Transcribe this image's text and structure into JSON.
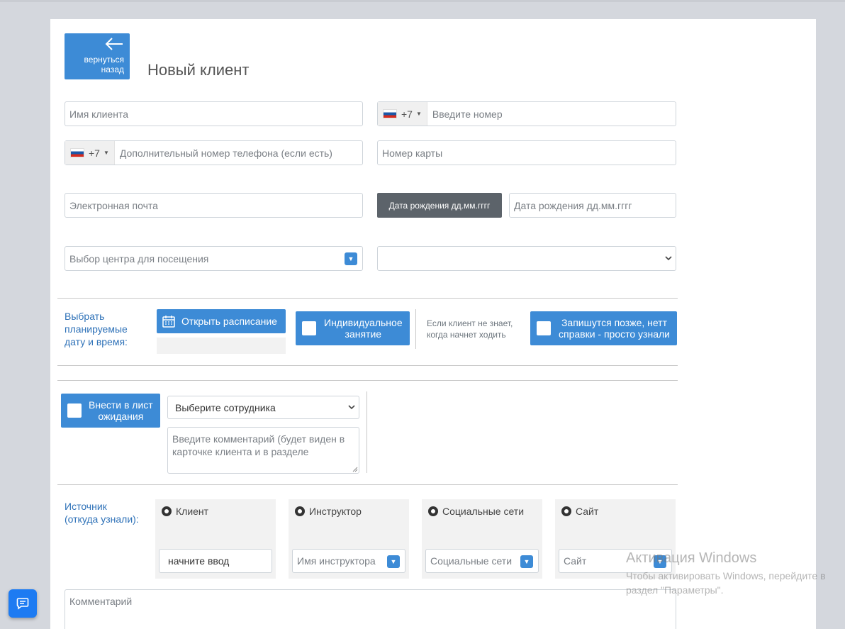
{
  "header": {
    "back_label_1": "вернуться",
    "back_label_2": "назад",
    "title": "Новый клиент"
  },
  "form": {
    "client_name_placeholder": "Имя клиента",
    "phone_code": "+7",
    "phone_placeholder": "Введите номер",
    "extra_phone_code": "+7",
    "extra_phone_placeholder": "Дополнительный номер телефона (если есть)",
    "card_placeholder": "Номер карты",
    "email_placeholder": "Электронная почта",
    "dob_label": "Дата рождения дд.мм.гггг",
    "dob_placeholder": "Дата рождения дд.мм.гггг",
    "center_placeholder": "Выбор центра для посещения",
    "second_select_value": ""
  },
  "schedule": {
    "label_1": "Выбрать",
    "label_2": "планируемые",
    "label_3": "дату и время:",
    "open_schedule": "Открыть расписание",
    "individual_1": "Индивидуальное",
    "individual_2": "занятие",
    "unknown_1": "Если клиент не знает,",
    "unknown_2": "когда начнет ходить",
    "later_1": "Запишутся позже, нетт",
    "later_2": "справки - просто узнали"
  },
  "waitlist": {
    "label_1": "Внести в лист",
    "label_2": "ожидания",
    "employee_select": "Выберите сотрудника",
    "comment_placeholder_1": "Введите комментарий (будет виден в",
    "comment_placeholder_2": "карточке клиента и в разделе"
  },
  "source": {
    "label_1": "Источник",
    "label_2": "(откуда узнали):",
    "options": [
      {
        "label": "Клиент",
        "input": "начните ввод"
      },
      {
        "label": "Инструктор",
        "input": "Имя инструктора"
      },
      {
        "label": "Социальные сети",
        "input": "Социальные сети"
      },
      {
        "label": "Сайт",
        "input": "Сайт"
      }
    ]
  },
  "comment_placeholder": "Комментарий",
  "watermark": {
    "title": "Активация Windows",
    "line1": "Чтобы активировать Windows, перейдите в",
    "line2": "раздел \"Параметры\"."
  },
  "colors": {
    "accent": "#3d8bd6",
    "dark_button": "#5c636a",
    "label_blue": "#2f72b8"
  },
  "icons": [
    "arrow-left-icon",
    "calendar-icon",
    "chat-icon",
    "chevron-down-icon"
  ]
}
